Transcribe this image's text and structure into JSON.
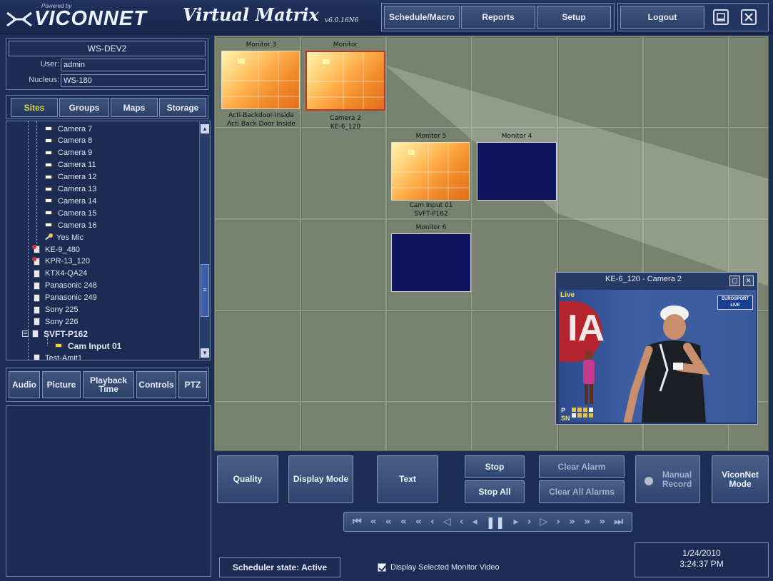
{
  "header": {
    "powered_by": "Powered by",
    "brand": "VICONNET",
    "app_title": "Virtual Matrix",
    "version": "v6.0.16N6",
    "nav": [
      "Schedule/Macro",
      "Reports",
      "Setup"
    ],
    "logout": "Logout"
  },
  "workstation": {
    "name": "WS-DEV2",
    "user_label": "User:",
    "user": "admin",
    "nucleus_label": "Nucleus:",
    "nucleus": "WS-180"
  },
  "site_tabs": [
    "Sites",
    "Groups",
    "Maps",
    "Storage"
  ],
  "tree": [
    {
      "label": "Camera 7",
      "kind": "camera"
    },
    {
      "label": "Camera 8",
      "kind": "camera"
    },
    {
      "label": "Camera 9",
      "kind": "camera"
    },
    {
      "label": "Camera 11",
      "kind": "camera"
    },
    {
      "label": "Camera 12",
      "kind": "camera"
    },
    {
      "label": "Camera 13",
      "kind": "camera"
    },
    {
      "label": "Camera 14",
      "kind": "camera"
    },
    {
      "label": "Camera 15",
      "kind": "camera"
    },
    {
      "label": "Camera 16",
      "kind": "camera"
    },
    {
      "label": "Yes Mic",
      "kind": "mic"
    },
    {
      "label": "KE-9_480",
      "kind": "server-alert"
    },
    {
      "label": "KPR-13_120",
      "kind": "server-alert"
    },
    {
      "label": "KTX4-QA24",
      "kind": "server"
    },
    {
      "label": "Panasonic 248",
      "kind": "server"
    },
    {
      "label": "Panasonic 249",
      "kind": "server"
    },
    {
      "label": "Sony 225",
      "kind": "server"
    },
    {
      "label": "Sony 226",
      "kind": "server"
    },
    {
      "label": "SVFT-P162",
      "kind": "server-expanded"
    },
    {
      "label": "Cam Input 01",
      "kind": "camera-selected"
    },
    {
      "label": "Test-Amit1",
      "kind": "server"
    }
  ],
  "control_tabs": [
    {
      "label": "Audio"
    },
    {
      "label": "Picture"
    },
    {
      "label": "Playback Time"
    },
    {
      "label": "Controls"
    },
    {
      "label": "PTZ"
    }
  ],
  "monitors": {
    "m3": {
      "title": "Monitor 3",
      "line1": "Acti-Backdoor-Inside",
      "line2": "Acti Back Door Inside"
    },
    "m_sel": {
      "title": "Monitor",
      "line1": "Camera 2",
      "line2": "KE-6_120"
    },
    "m5": {
      "title": "Monitor 5",
      "line1": "Cam Input 01",
      "line2": "SVFT-P162"
    },
    "m4": {
      "title": "Monitor 4"
    },
    "m6": {
      "title": "Monitor 6"
    }
  },
  "video_window": {
    "title": "KE-6_120 - Camera 2",
    "live": "Live",
    "overlay_banner": "IA",
    "channel_logo": "EUROSPORT LIVE",
    "score_tag_p": "P",
    "score_tag_sn": "SN"
  },
  "controls": {
    "quality": "Quality",
    "display_mode": "Display Mode",
    "text": "Text",
    "stop": "Stop",
    "stop_all": "Stop All",
    "clear_alarm": "Clear Alarm",
    "clear_all_alarms": "Clear All Alarms",
    "manual_record": "Manual Record",
    "viconnet_mode": "ViconNet Mode"
  },
  "playback_symbols": [
    "⏮",
    "«",
    "«",
    "«",
    "«",
    "‹",
    "◁",
    "‹",
    "◂",
    "❚❚",
    "▸",
    "›",
    "▷",
    "›",
    "»",
    "»",
    "»",
    "⏭"
  ],
  "status": {
    "scheduler": "Scheduler state: Active",
    "display_selected": "Display Selected Monitor Video",
    "date": "1/24/2010",
    "time": "3:24:37 PM"
  }
}
